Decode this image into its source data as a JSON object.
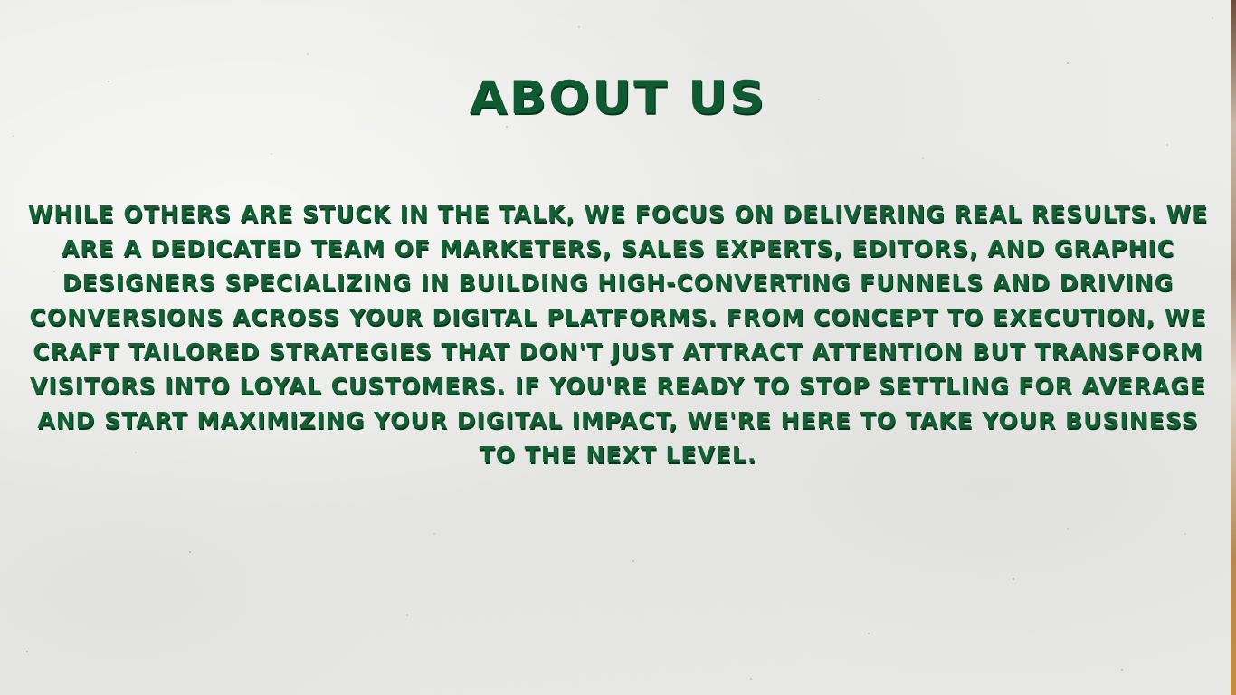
{
  "heading": "ABOUT US",
  "body": "WHILE OTHERS ARE STUCK IN THE TALK, WE FOCUS ON DELIVERING REAL RESULTS. WE ARE A DEDICATED TEAM OF MARKETERS, SALES EXPERTS, EDITORS, AND GRAPHIC DESIGNERS SPECIALIZING IN BUILDING HIGH-CONVERTING FUNNELS AND DRIVING CONVERSIONS ACROSS YOUR DIGITAL PLATFORMS. FROM CONCEPT TO EXECUTION, WE CRAFT TAILORED STRATEGIES THAT DON'T JUST ATTRACT ATTENTION BUT TRANSFORM VISITORS INTO LOYAL CUSTOMERS. IF YOU'RE READY TO STOP SETTLING FOR AVERAGE AND START MAXIMIZING YOUR DIGITAL IMPACT, WE'RE HERE TO TAKE YOUR BUSINESS TO THE NEXT LEVEL.",
  "colors": {
    "text": "#126236",
    "shadow": "#0a2f1b",
    "background": "#ececea"
  }
}
